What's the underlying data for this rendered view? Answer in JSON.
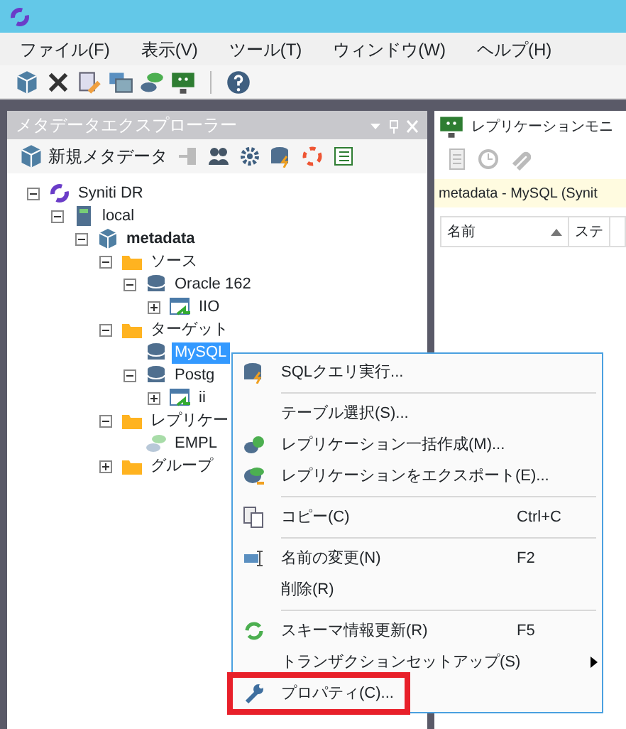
{
  "menu_bar": [
    {
      "label": "ファイル(F)"
    },
    {
      "label": "表示(V)"
    },
    {
      "label": "ツール(T)"
    },
    {
      "label": "ウィンドウ(W)"
    },
    {
      "label": "ヘルプ(H)"
    }
  ],
  "explorer": {
    "title": "メタデータエクスプローラー",
    "new_button": "新規メタデータ",
    "tree": [
      {
        "label": "Syniti DR",
        "kind": "root",
        "expanded": true,
        "selected": false,
        "children": [
          {
            "label": "local",
            "kind": "server",
            "expanded": true,
            "selected": false,
            "children": [
              {
                "label": "metadata",
                "kind": "schema",
                "expanded": true,
                "selected": false,
                "children": [
                  {
                    "label": "ソース",
                    "kind": "folder",
                    "expanded": true,
                    "selected": false,
                    "children": [
                      {
                        "label": "Oracle 162",
                        "kind": "database",
                        "expanded": true,
                        "selected": false,
                        "children": [
                          {
                            "label": "IIO",
                            "kind": "table",
                            "expanded": false,
                            "selected": false
                          }
                        ]
                      }
                    ]
                  },
                  {
                    "label": "ターゲット",
                    "kind": "folder",
                    "expanded": true,
                    "selected": false,
                    "children": [
                      {
                        "label": "MySQL",
                        "kind": "database",
                        "selected": true
                      },
                      {
                        "label": "Postg",
                        "kind": "database",
                        "expanded": true,
                        "selected": false,
                        "children": [
                          {
                            "label": "ii",
                            "kind": "table",
                            "expanded": false,
                            "selected": false
                          }
                        ]
                      }
                    ]
                  },
                  {
                    "label": "レプリケー",
                    "kind": "folder",
                    "expanded": true,
                    "selected": false,
                    "children": [
                      {
                        "label": "EMPL",
                        "kind": "replication",
                        "selected": false
                      }
                    ]
                  },
                  {
                    "label": "グループ",
                    "kind": "folder",
                    "expanded": false,
                    "selected": false
                  }
                ]
              }
            ]
          }
        ]
      }
    ]
  },
  "monitor": {
    "title": "レプリケーションモニ",
    "info": "metadata - MySQL (Synit",
    "columns": [
      {
        "label": "名前",
        "sorted": true
      },
      {
        "label": "ステ",
        "sorted": false
      }
    ]
  },
  "context_menu": {
    "items": [
      {
        "kind": "item",
        "label": "SQLクエリ実行...",
        "highlighted": false
      },
      {
        "kind": "separator"
      },
      {
        "kind": "item",
        "label": "テーブル選択(S)...",
        "highlighted": false
      },
      {
        "kind": "item",
        "label": "レプリケーション一括作成(M)...",
        "highlighted": false
      },
      {
        "kind": "item",
        "label": "レプリケーションをエクスポート(E)...",
        "highlighted": false
      },
      {
        "kind": "separator"
      },
      {
        "kind": "item",
        "label": "コピー(C)",
        "shortcut": "Ctrl+C",
        "highlighted": false
      },
      {
        "kind": "separator"
      },
      {
        "kind": "item",
        "label": "名前の変更(N)",
        "shortcut": "F2",
        "highlighted": false
      },
      {
        "kind": "item",
        "label": "削除(R)",
        "highlighted": false
      },
      {
        "kind": "separator"
      },
      {
        "kind": "item",
        "label": "スキーマ情報更新(R)",
        "shortcut": "F5",
        "highlighted": false
      },
      {
        "kind": "item",
        "label": "トランザクションセットアップ(S)",
        "submenu": true,
        "highlighted": false
      },
      {
        "kind": "item",
        "label": "プロパティ(C)...",
        "highlighted": true
      }
    ]
  }
}
